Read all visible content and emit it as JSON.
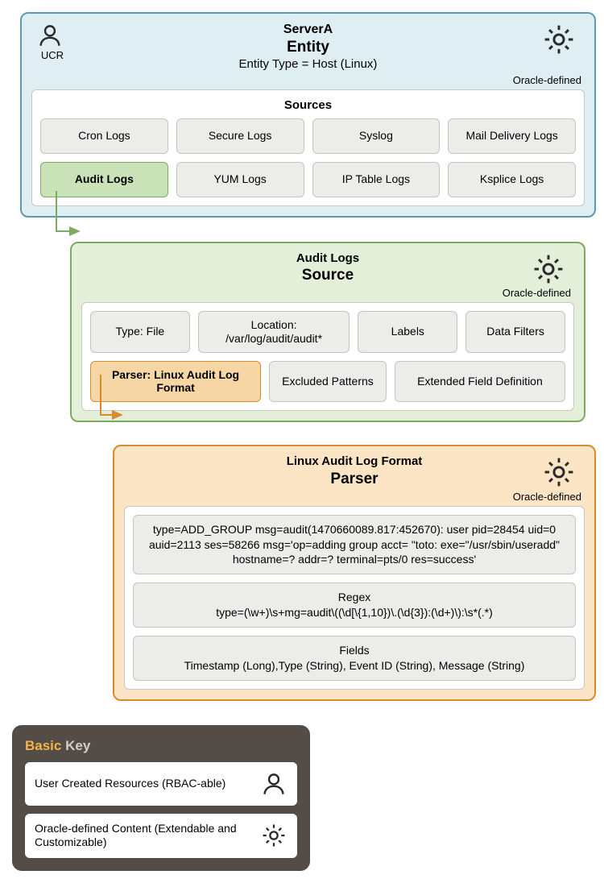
{
  "entity": {
    "server": "ServerA",
    "label": "Entity",
    "type_line": "Entity Type = Host (Linux)",
    "ucr": "UCR",
    "oracle": "Oracle-defined",
    "sources_title": "Sources",
    "sources": [
      "Cron Logs",
      "Secure Logs",
      "Syslog",
      "Mail Delivery Logs",
      "Audit Logs",
      "YUM Logs",
      "IP Table Logs",
      "Ksplice Logs"
    ]
  },
  "source": {
    "name": "Audit Logs",
    "label": "Source",
    "oracle": "Oracle-defined",
    "row1": [
      "Type: File",
      "Location: /var/log/audit/audit*",
      "Labels",
      "Data Filters"
    ],
    "row2": [
      "Parser: Linux Audit Log Format",
      "Excluded Patterns",
      "Extended Field Definition"
    ]
  },
  "parser": {
    "name": "Linux Audit Log Format",
    "label": "Parser",
    "oracle": "Oracle-defined",
    "sample": "type=ADD_GROUP msg=audit(1470660089.817:452670): user pid=28454 uid=0 auid=2113 ses=58266 msg='op=adding group acct= \"toto: exe=\"/usr/sbin/useradd\" hostname=? addr=? terminal=pts/0 res=success'",
    "regex_label": "Regex",
    "regex": "type=(\\w+)\\s+mg=audit\\((\\d[\\{1,10})\\.(\\d{3}):(\\d+)\\):\\s*(.*)",
    "fields_label": "Fields",
    "fields": "Timestamp (Long),Type (String), Event ID (String), Message (String)"
  },
  "key": {
    "title1": "Basic",
    "title2": "Key",
    "ucr": "User Created Resources (RBAC-able)",
    "oracle": "Oracle-defined Content (Extendable and Customizable)"
  }
}
